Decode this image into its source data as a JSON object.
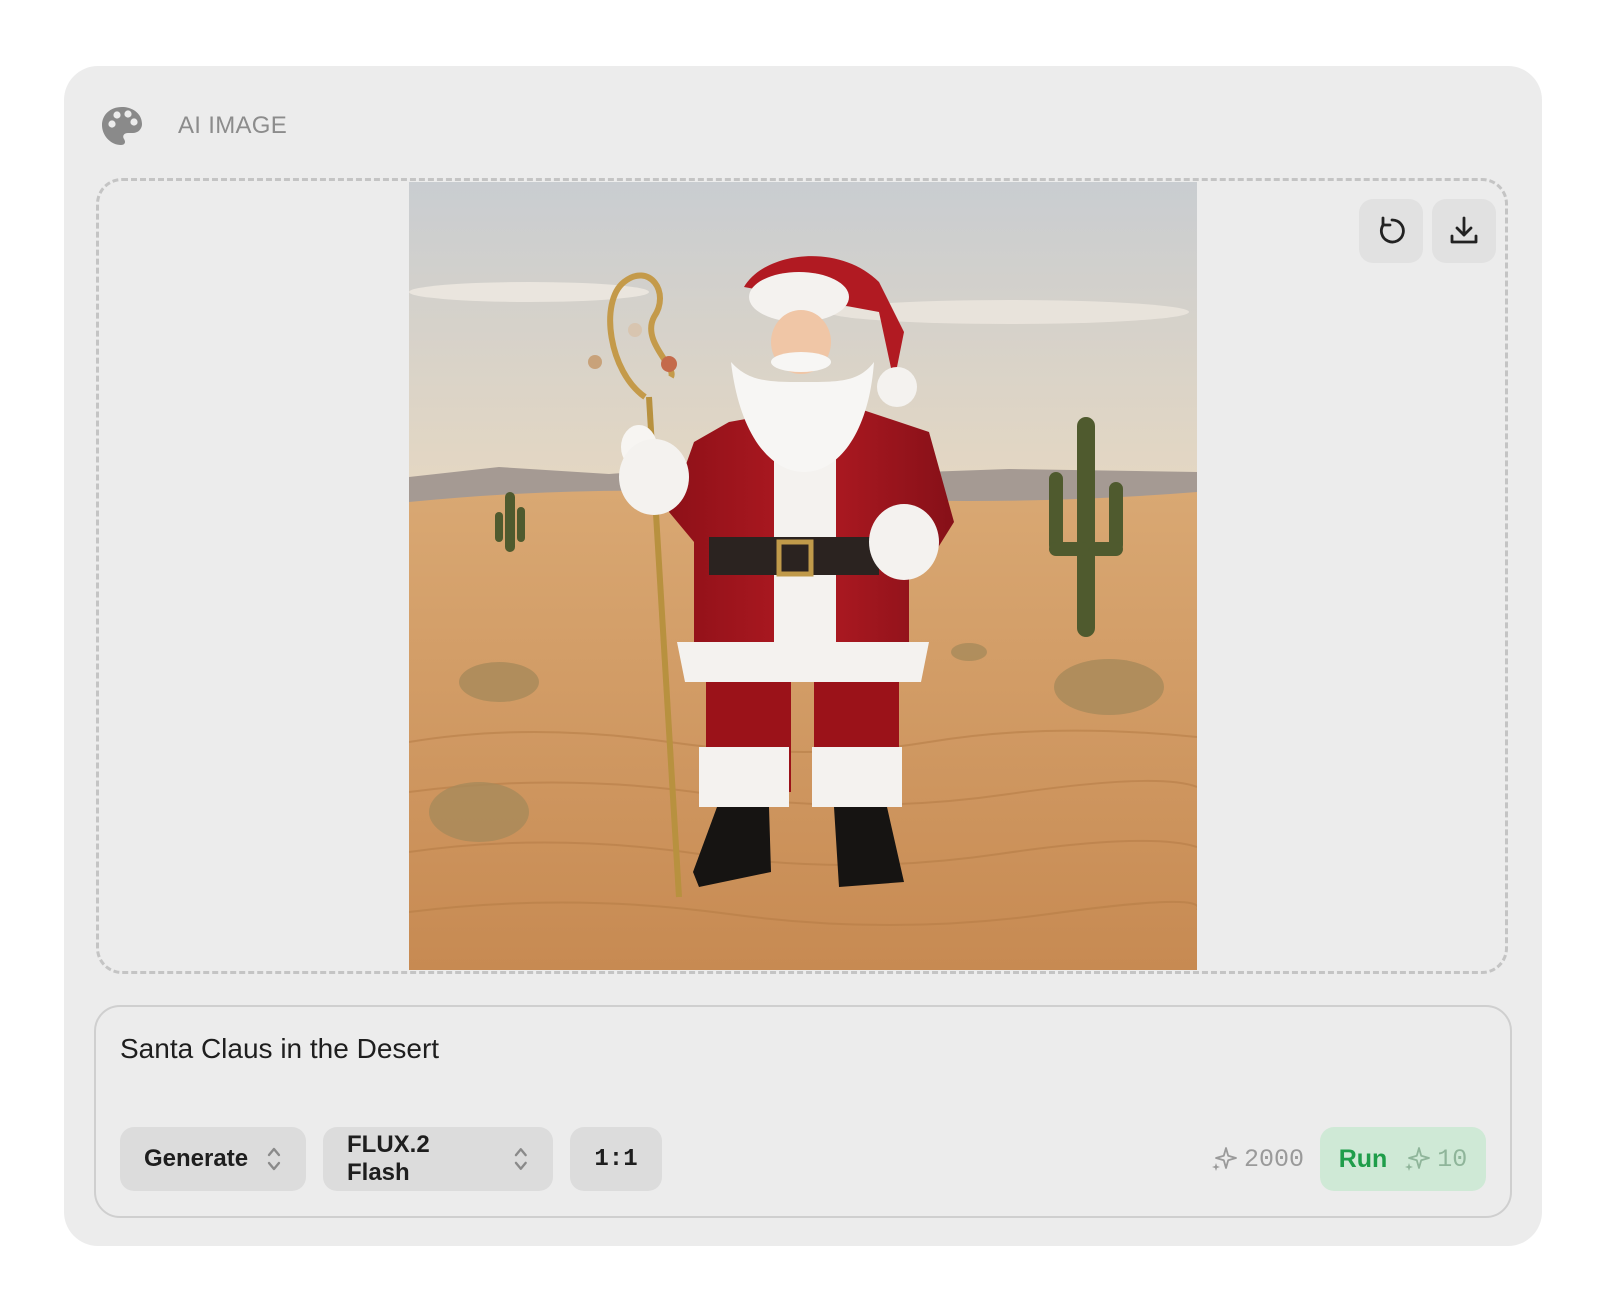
{
  "header": {
    "icon": "palette-icon",
    "title": "AI IMAGE"
  },
  "preview": {
    "image_subject": "Santa Claus in the Desert",
    "actions": [
      {
        "icon": "refresh-icon",
        "label": "Regenerate"
      },
      {
        "icon": "download-icon",
        "label": "Download"
      }
    ]
  },
  "prompt": {
    "text": "Santa Claus in the Desert"
  },
  "toolbar": {
    "mode": "Generate",
    "model": "FLUX.2 Flash",
    "ratio": "1:1",
    "credits_balance": "2000",
    "run_label": "Run",
    "run_cost": "10"
  },
  "colors": {
    "card_bg": "#ececec",
    "run_bg": "#cfe9d6",
    "run_text": "#1f9d4a",
    "muted_text": "#8c8c8c"
  }
}
